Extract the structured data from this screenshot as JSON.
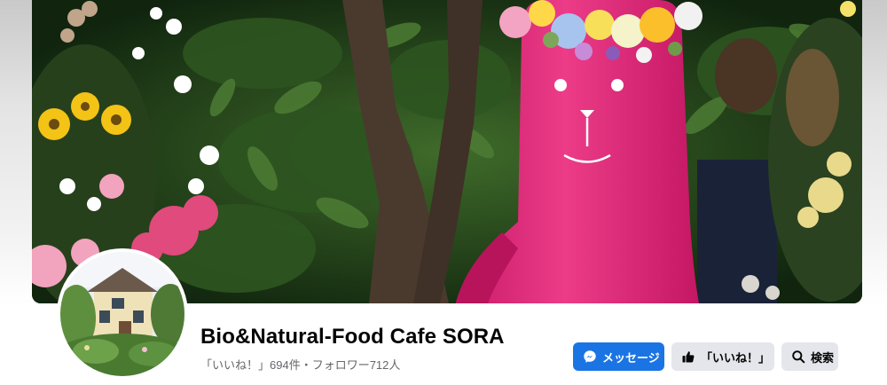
{
  "page": {
    "name": "Bio&Natural-Food Cafe SORA",
    "stats": "「いいね！」694件・フォロワー712人"
  },
  "actions": {
    "message_label": "メッセージ",
    "like_label": "「いいね！」",
    "search_label": "検索"
  },
  "icons": {
    "message": "messenger-icon",
    "like": "thumbs-up-icon",
    "search": "search-icon"
  },
  "colors": {
    "primary_button": "#1b74e4",
    "secondary_button": "#e4e6eb",
    "name_text": "#050505",
    "secondary_text": "#65676b"
  }
}
